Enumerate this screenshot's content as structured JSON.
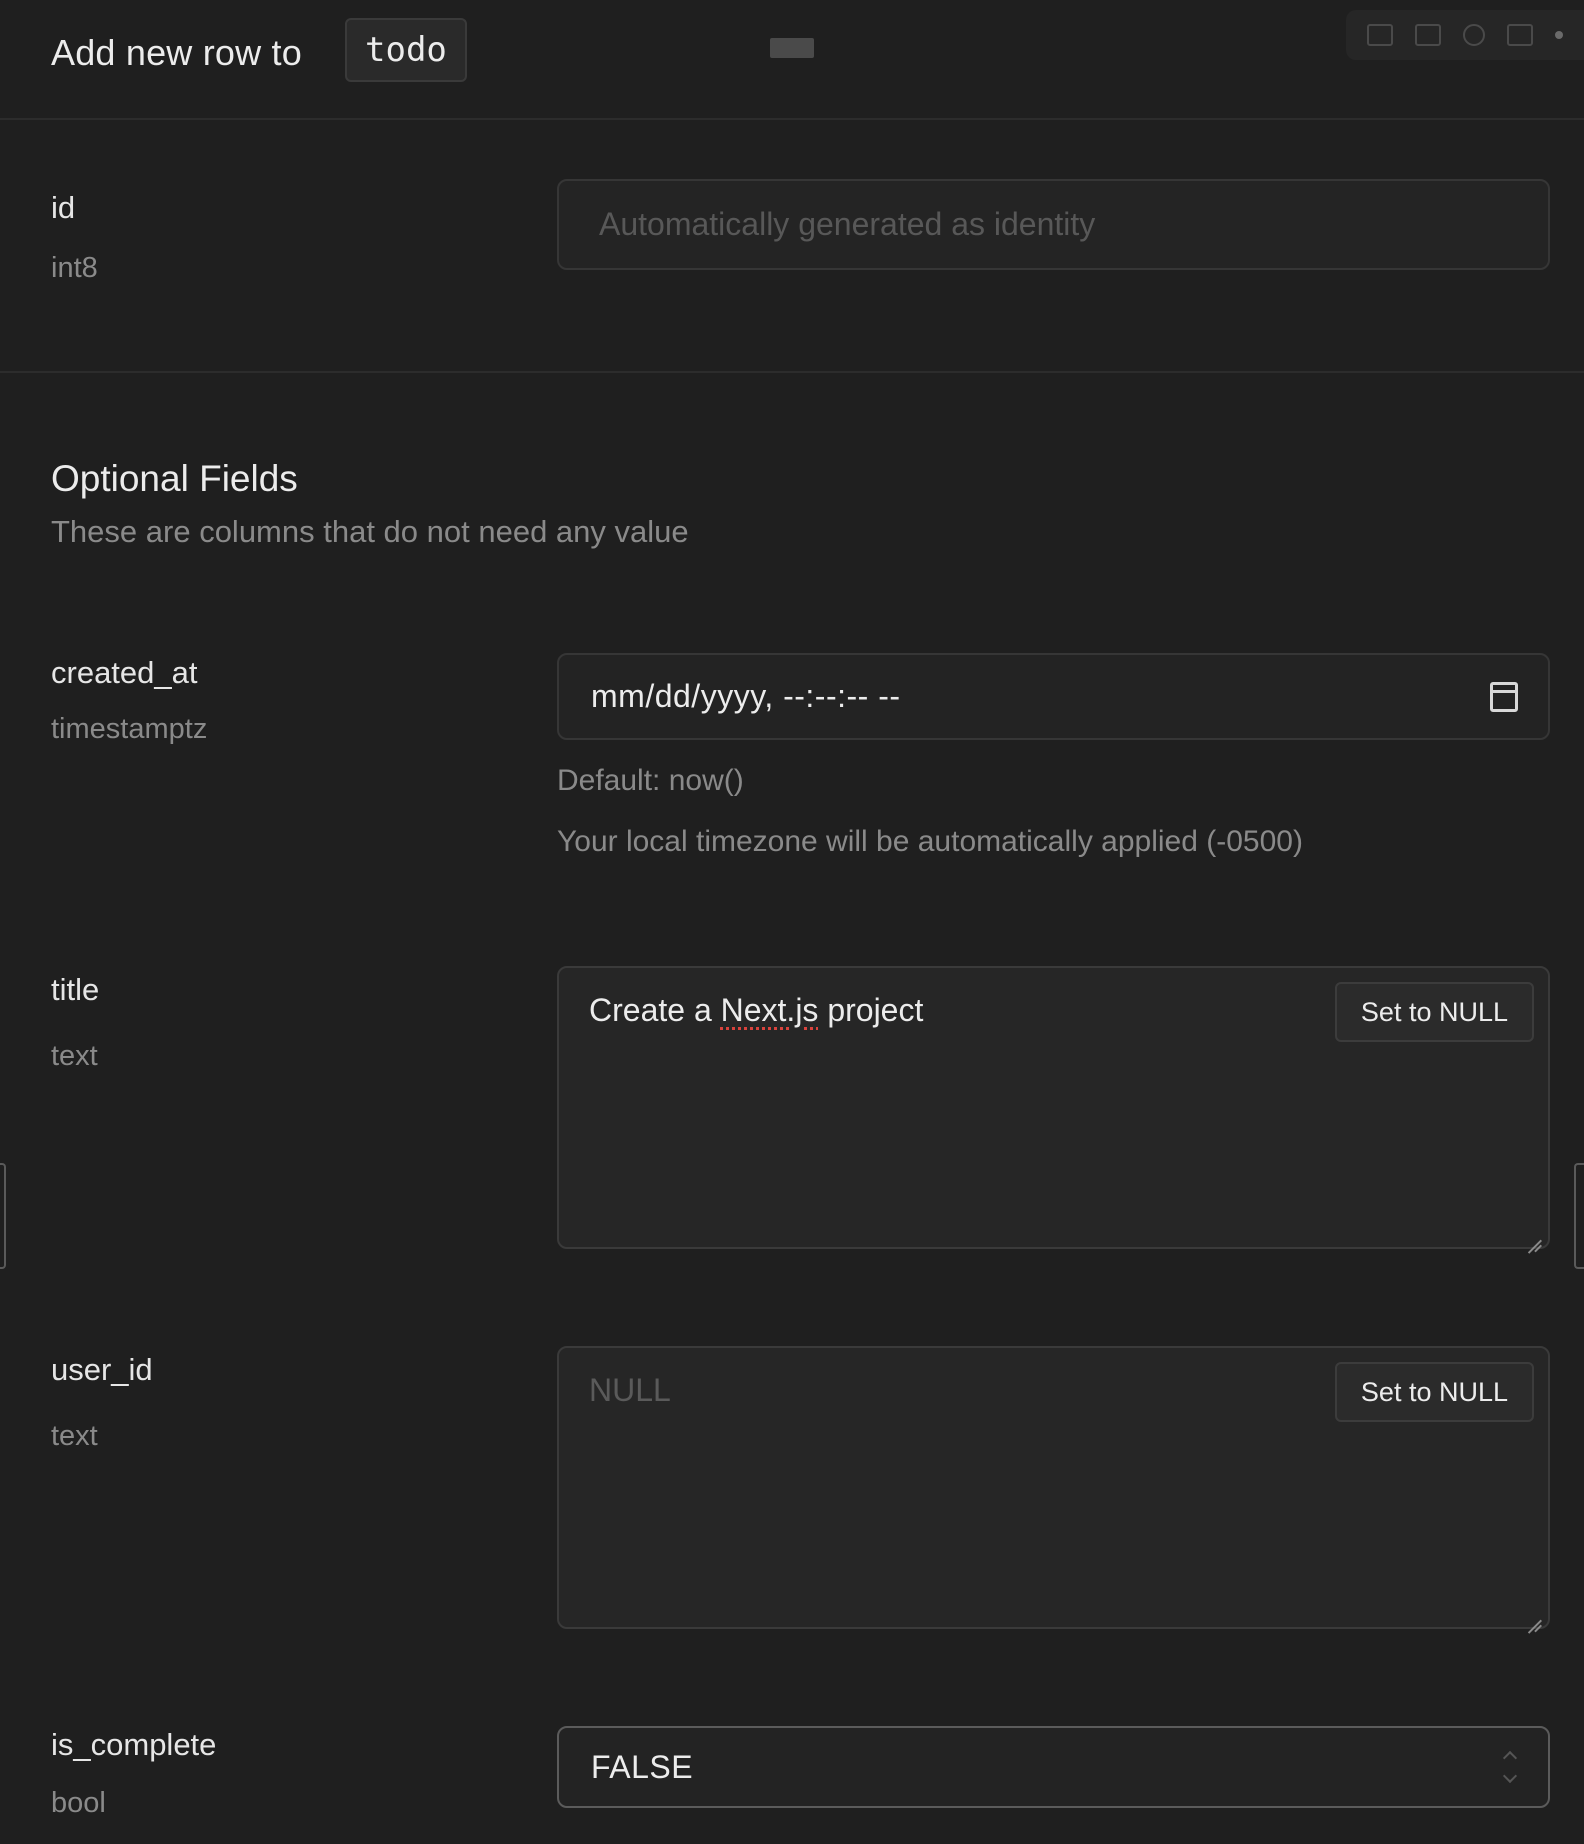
{
  "header": {
    "title": "Add new row to",
    "table_name": "todo"
  },
  "fields": {
    "id": {
      "name": "id",
      "type": "int8",
      "placeholder": "Automatically generated as identity"
    },
    "optional_section": {
      "title": "Optional Fields",
      "description": "These are columns that do not need any value"
    },
    "created_at": {
      "name": "created_at",
      "type": "timestamptz",
      "value": "mm/dd/yyyy, --:--:-- --",
      "default_hint": "Default: now()",
      "timezone_hint": "Your local timezone will be automatically applied (-0500)"
    },
    "title": {
      "name": "title",
      "type": "text",
      "value_before": "Create a ",
      "value_misspelled": "Next.js",
      "value_after": " project",
      "null_button": "Set to NULL"
    },
    "user_id": {
      "name": "user_id",
      "type": "text",
      "placeholder": "NULL",
      "null_button": "Set to NULL"
    },
    "is_complete": {
      "name": "is_complete",
      "type": "bool",
      "value": "FALSE"
    }
  }
}
